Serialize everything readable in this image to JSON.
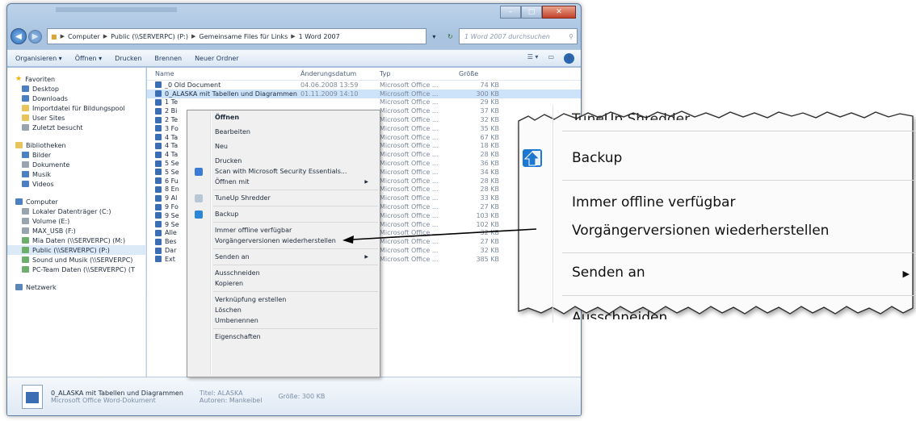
{
  "address": {
    "crumbs": [
      "Computer",
      "Public (\\\\SERVERPC) (P:)",
      "Gemeinsame Files für Links",
      "1 Word 2007"
    ],
    "search_placeholder": "1 Word 2007 durchsuchen"
  },
  "toolbar": {
    "organize": "Organisieren ▾",
    "open": "Öffnen ▾",
    "print": "Drucken",
    "burn": "Brennen",
    "new_folder": "Neuer Ordner"
  },
  "nav": {
    "favorites": "Favoriten",
    "fav_items": [
      "Desktop",
      "Downloads",
      "Importdatei für Bildungspool",
      "User Sites",
      "Zuletzt besucht"
    ],
    "libraries": "Bibliotheken",
    "lib_items": [
      "Bilder",
      "Dokumente",
      "Musik",
      "Videos"
    ],
    "computer": "Computer",
    "comp_items": [
      "Lokaler Datenträger (C:)",
      "Volume (E:)",
      "MAX_USB (F:)",
      "Mia Daten (\\\\SERVERPC) (M:)",
      "Public (\\\\SERVERPC) (P:)",
      "Sound und Musik (\\\\SERVERPC)",
      "PC-Team Daten (\\\\SERVERPC) (T"
    ],
    "network": "Netzwerk"
  },
  "columns": {
    "name": "Name",
    "date": "Änderungsdatum",
    "type": "Typ",
    "size": "Größe"
  },
  "files": [
    {
      "name": "_0 Old Document",
      "date": "04.06.2008 13:59",
      "type": "Microsoft Office ...",
      "size": "74 KB"
    },
    {
      "name": "0_ALASKA mit Tabellen und Diagrammen",
      "date": "01.11.2009 14:10",
      "type": "Microsoft Office ...",
      "size": "300 KB"
    },
    {
      "name": "1 Te",
      "date": "",
      "type": "Microsoft Office ...",
      "size": "29 KB"
    },
    {
      "name": "2 Bi",
      "date": "",
      "type": "Microsoft Office ...",
      "size": "37 KB"
    },
    {
      "name": "2 Te",
      "date": "",
      "type": "Microsoft Office ...",
      "size": "32 KB"
    },
    {
      "name": "3 Fo",
      "date": "",
      "type": "Microsoft Office ...",
      "size": "35 KB"
    },
    {
      "name": "4 Ta",
      "date": "",
      "type": "Microsoft Office ...",
      "size": "67 KB"
    },
    {
      "name": "4 Ta",
      "date": "",
      "type": "Microsoft Office ...",
      "size": "18 KB"
    },
    {
      "name": "4 Ta",
      "date": "",
      "type": "Microsoft Office ...",
      "size": "28 KB"
    },
    {
      "name": "5 Se",
      "date": "",
      "type": "Microsoft Office ...",
      "size": "36 KB"
    },
    {
      "name": "5 Se",
      "date": "",
      "type": "Microsoft Office ...",
      "size": "34 KB"
    },
    {
      "name": "6 Fu",
      "date": "",
      "type": "Microsoft Office ...",
      "size": "28 KB"
    },
    {
      "name": "8 En",
      "date": "",
      "type": "Microsoft Office ...",
      "size": "28 KB"
    },
    {
      "name": "9 Al",
      "date": "",
      "type": "Microsoft Office ...",
      "size": "33 KB"
    },
    {
      "name": "9 Fo",
      "date": "",
      "type": "Microsoft Office ...",
      "size": "27 KB"
    },
    {
      "name": "9 Se",
      "date": "",
      "type": "Microsoft Office ...",
      "size": "103 KB"
    },
    {
      "name": "9 Se",
      "date": "",
      "type": "Microsoft Office ...",
      "size": "102 KB"
    },
    {
      "name": "Alle",
      "date": "",
      "type": "Microsoft Office ...",
      "size": "32 KB"
    },
    {
      "name": "Bes",
      "date": "",
      "type": "Microsoft Office ...",
      "size": "27 KB"
    },
    {
      "name": "Dar",
      "date": "",
      "type": "Microsoft Office ...",
      "size": "32 KB"
    },
    {
      "name": "Ext",
      "date": "",
      "type": "Microsoft Office ...",
      "size": "385 KB"
    }
  ],
  "context_menu": {
    "open": "Öffnen",
    "edit": "Bearbeiten",
    "new": "Neu",
    "print": "Drucken",
    "scan": "Scan with Microsoft Security Essentials...",
    "open_with": "Öffnen mit",
    "shredder": "TuneUp Shredder",
    "backup": "Backup",
    "offline": "Immer offline verfügbar",
    "restore": "Vorgängerversionen wiederherstellen",
    "send_to": "Senden an",
    "cut": "Ausschneiden",
    "copy": "Kopieren",
    "shortcut": "Verknüpfung erstellen",
    "delete": "Löschen",
    "rename": "Umbenennen",
    "properties": "Eigenschaften"
  },
  "details": {
    "filename": "0_ALASKA mit Tabellen und Diagrammen",
    "filetype": "Microsoft Office Word-Dokument",
    "title": "Titel: ALASKA",
    "author": "Autoren: Mankeibel",
    "size": "Größe: 300 KB"
  },
  "zoom": {
    "top_cut": "TuneUp Shredder",
    "backup": "Backup",
    "offline": "Immer offline verfügbar",
    "restore": "Vorgängerversionen wiederherstellen",
    "send_to": "Senden an",
    "bottom_cut": "Ausschneiden"
  }
}
